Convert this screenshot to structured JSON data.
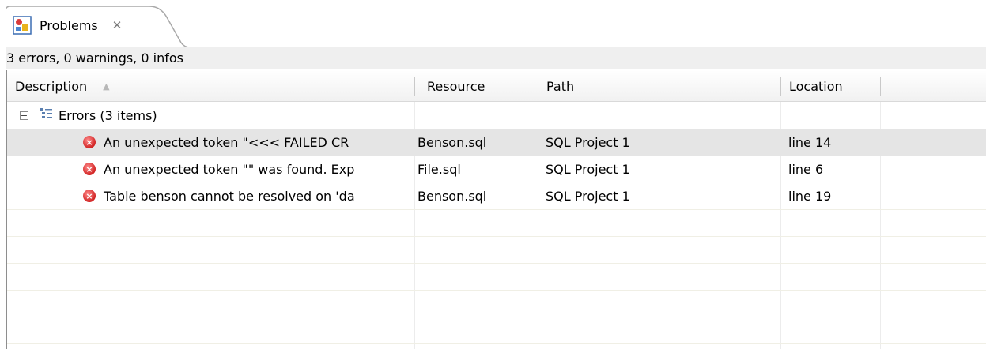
{
  "tab": {
    "icon": "problems-icon",
    "label": "Problems",
    "close": "✕"
  },
  "status": "3 errors, 0 warnings, 0 infos",
  "columns": [
    "Description",
    "Resource",
    "Path",
    "Location"
  ],
  "sort_indicator": "ascending",
  "group": {
    "expander": "−",
    "icon": "error-group-icon",
    "label": "Errors (3 items)"
  },
  "rows": [
    {
      "description": "An unexpected token \"<<< FAILED CR",
      "resource": "Benson.sql",
      "path": "SQL Project 1",
      "location": "line 14",
      "selected": true
    },
    {
      "description": "An unexpected token \"\" was found. Exp",
      "resource": "File.sql",
      "path": "SQL Project 1",
      "location": "line 6",
      "selected": false
    },
    {
      "description": "Table benson cannot be resolved on 'da",
      "resource": "Benson.sql",
      "path": "SQL Project 1",
      "location": "line 19",
      "selected": false
    }
  ],
  "colors": {
    "selection": "#e5e5e5",
    "error": "#d12424",
    "status_bg": "#efefef"
  }
}
